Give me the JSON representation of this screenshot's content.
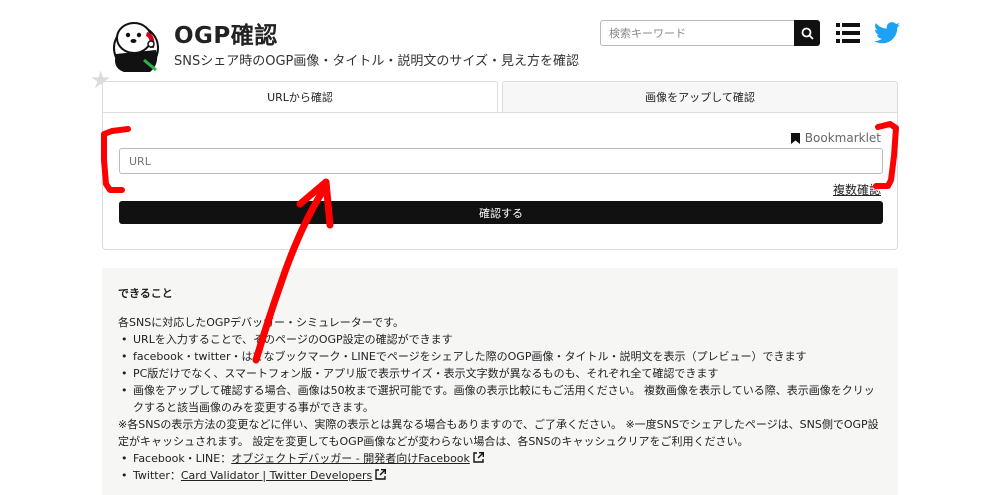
{
  "header": {
    "title": "OGP確認",
    "subtitle": "SNSシェア時のOGP画像・タイトル・説明文のサイズ・見え方を確認",
    "search_placeholder": "検索キーワード"
  },
  "tabs": [
    {
      "label": "URLから確認",
      "active": true
    },
    {
      "label": "画像をアップして確認",
      "active": false
    }
  ],
  "form": {
    "bookmarklet_label": "Bookmarklet",
    "url_placeholder": "URL",
    "url_value": "",
    "multi_label": "複数確認",
    "submit_label": "確認する"
  },
  "info": {
    "heading": "できること",
    "intro": "各SNSに対応したOGPデバッガー・シミュレーターです。",
    "bullets": [
      "URLを入力することで、そのページのOGP設定の確認ができます",
      "facebook・twitter・はてなブックマーク・LINEでページをシェアした際のOGP画像・タイトル・説明文を表示（プレビュー）できます",
      "PC版だけでなく、スマートフォン版・アプリ版で表示サイズ・表示文字数が異なるものも、それぞれ全て確認できます",
      "画像をアップして確認する場合、画像は50枚まで選択可能です。画像の表示比較にもご活用ください。 複数画像を表示している際、表示画像をクリックすると該当画像のみを変更する事ができます。"
    ],
    "note": "※各SNSの表示方法の変更などに伴い、実際の表示とは異なる場合もありますので、ご了承ください。 ※一度SNSでシェアしたページは、SNS側でOGP設定がキャッシュされます。 設定を変更してもOGP画像などが変わらない場合は、各SNSのキャッシュクリアをご利用ください。",
    "links": [
      {
        "prefix": "Facebook・LINE：",
        "text": "オブジェクトデバッガー - 開発者向けFacebook"
      },
      {
        "prefix": "Twitter：",
        "text": "Card Validator | Twitter Developers"
      }
    ]
  },
  "colors": {
    "accent": "#111111",
    "twitter": "#1da1f2",
    "annotation": "#ff0000",
    "info_bg": "#f6f6f5"
  },
  "icons": [
    "otter-logo",
    "star-icon",
    "search-icon",
    "menu-icon",
    "twitter-icon",
    "bookmark-icon",
    "external-link-icon"
  ]
}
